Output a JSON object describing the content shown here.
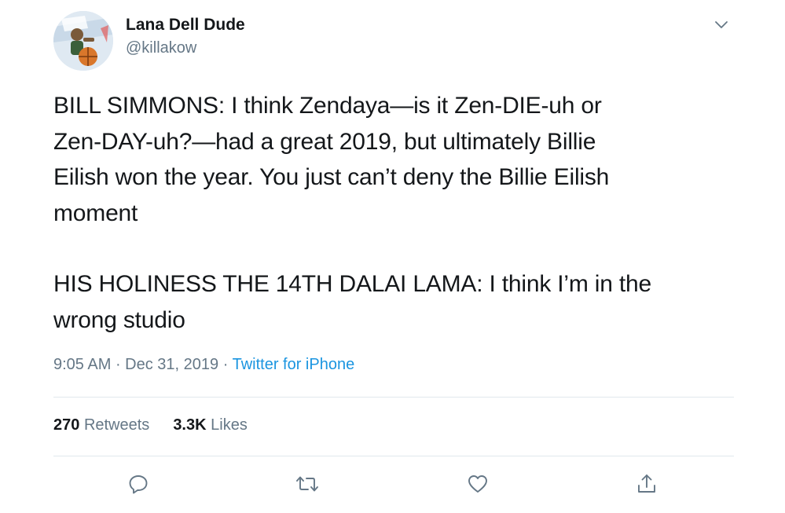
{
  "user": {
    "display_name": "Lana Dell Dude",
    "handle": "@killakow",
    "avatar_icon": "avatar-basketball-player-icon"
  },
  "tweet": {
    "paragraph1_lines": [
      "BILL SIMMONS: I think Zendaya—is it Zen-DIE-uh or",
      "Zen-DAY-uh?—had a great 2019, but ultimately Billie",
      "Eilish won the year. You just can’t deny the Billie Eilish",
      "moment"
    ],
    "paragraph2_lines": [
      "HIS HOLINESS THE 14TH DALAI LAMA: I think I’m in the",
      "wrong studio"
    ]
  },
  "meta": {
    "time": "9:05 AM",
    "separator": " · ",
    "date": "Dec 31, 2019",
    "separator2": " · ",
    "source": "Twitter for iPhone"
  },
  "stats": {
    "retweets_count": "270",
    "retweets_label": "Retweets",
    "likes_count": "3.3K",
    "likes_label": "Likes"
  },
  "actions": {
    "reply_icon": "reply-icon",
    "retweet_icon": "retweet-icon",
    "like_icon": "heart-icon",
    "share_icon": "share-icon",
    "more_icon": "chevron-down-icon"
  },
  "colors": {
    "text": "#14171a",
    "secondary": "#657786",
    "link": "#1b95e0",
    "divider": "#e1e8ed"
  }
}
